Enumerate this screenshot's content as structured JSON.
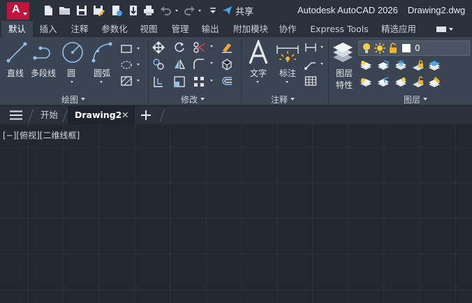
{
  "app": {
    "logo_letter": "A",
    "product": "Autodesk AutoCAD 2026",
    "document": "Drawing2.dwg",
    "share_label": "共享"
  },
  "quick_access": [
    "new-icon",
    "open-icon",
    "save-icon",
    "save-as-icon",
    "open-from-web-icon",
    "save-to-web-icon",
    "print-icon",
    "undo-icon",
    "redo-icon",
    "customize-icon"
  ],
  "ribbon_tabs": [
    "默认",
    "插入",
    "注释",
    "参数化",
    "视图",
    "管理",
    "输出",
    "附加模块",
    "协作",
    "Express Tools",
    "精选应用"
  ],
  "active_tab": "默认",
  "panels": {
    "draw": {
      "title": "绘图",
      "buttons": [
        "直线",
        "多段线",
        "圆",
        "圆弧"
      ]
    },
    "modify": {
      "title": "修改"
    },
    "annotation": {
      "title": "注释",
      "buttons": [
        "文字",
        "标注"
      ]
    },
    "layers": {
      "title": "图层",
      "properties_line1": "图层",
      "properties_line2": "特性",
      "current_layer": "0"
    }
  },
  "file_tabs": {
    "start": "开始",
    "active": "Drawing2"
  },
  "viewport_label": "[−][俯视][二维线框]",
  "colors": {
    "accent_logo": "#c2143b",
    "ribbon_bg": "#3b4453",
    "titlebar_bg": "#2b313a",
    "canvas_bg": "#212830",
    "grid_line": "#2c343e",
    "icon_blue": "#8fc1ef"
  }
}
